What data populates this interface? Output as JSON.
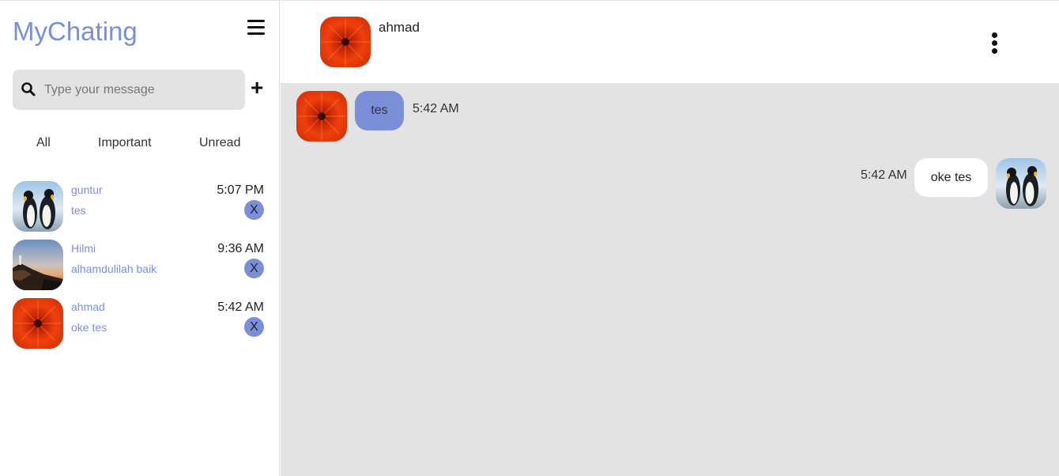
{
  "sidebar": {
    "brand": "MyChating",
    "search_placeholder": "Type your message",
    "tabs": [
      "All",
      "Important",
      "Unread"
    ],
    "contacts": [
      {
        "name": "guntur",
        "message": "tes",
        "time": "5:07 PM",
        "badge": "X",
        "avatar": "penguins"
      },
      {
        "name": "Hilmi",
        "message": "alhamdulilah baik",
        "time": "9:36 AM",
        "badge": "X",
        "avatar": "lighthouse"
      },
      {
        "name": "ahmad",
        "message": "oke tes",
        "time": "5:42 AM",
        "badge": "X",
        "avatar": "flower"
      }
    ]
  },
  "chat": {
    "name": "ahmad",
    "messages": [
      {
        "direction": "incoming",
        "text": "tes",
        "time": "5:42 AM"
      },
      {
        "direction": "outgoing",
        "text": "oke tes",
        "time": "5:42 AM"
      }
    ]
  },
  "colors": {
    "accent": "#7b8fd8",
    "chat_bg": "#e3e3e3"
  },
  "icons": [
    "menu-icon",
    "search-icon",
    "plus-icon",
    "kebab-menu-icon"
  ]
}
